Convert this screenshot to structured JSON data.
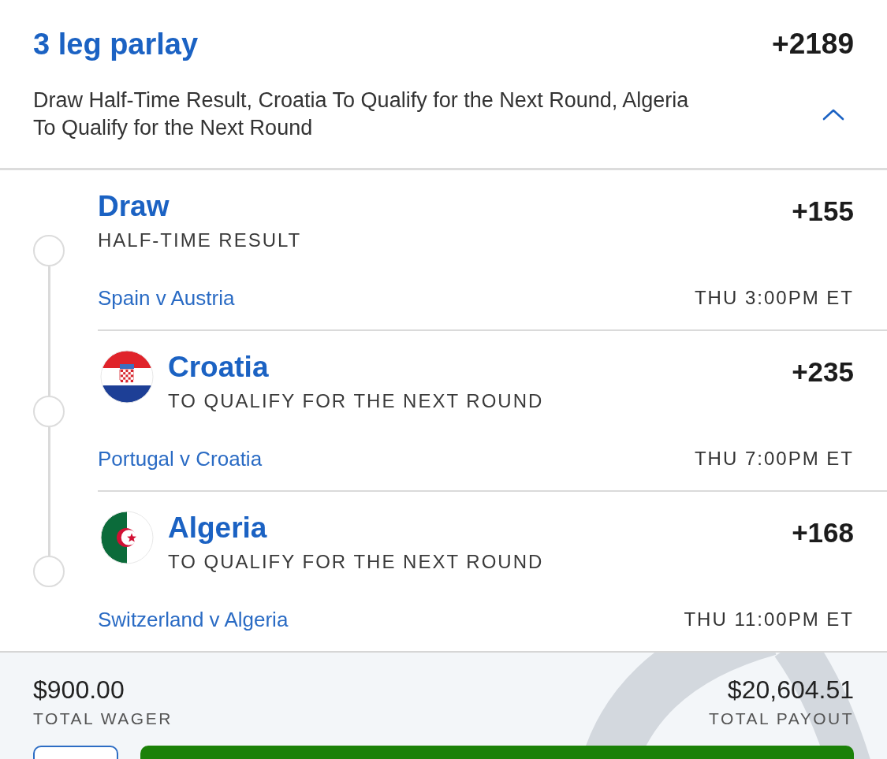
{
  "parlay": {
    "title": "3 leg parlay",
    "odds": "+2189",
    "description": "Draw Half-Time Result, Croatia To Qualify for the Next Round, Algeria To Qualify for the Next Round",
    "expanded": true
  },
  "legs": [
    {
      "kind": "plain",
      "selection": "Draw",
      "market": "HALF-TIME RESULT",
      "odds": "+155",
      "matchup": "Spain v Austria",
      "start_time": "THU 3:00PM ET"
    },
    {
      "kind": "croatia",
      "selection": "Croatia",
      "market": "TO QUALIFY FOR THE NEXT ROUND",
      "odds": "+235",
      "matchup": "Portugal v Croatia",
      "start_time": "THU 7:00PM ET"
    },
    {
      "kind": "algeria",
      "selection": "Algeria",
      "market": "TO QUALIFY FOR THE NEXT ROUND",
      "odds": "+168",
      "matchup": "Switzerland v Algeria",
      "start_time": "THU 11:00PM ET"
    }
  ],
  "summary": {
    "total_wager": "$900.00",
    "total_wager_label": "TOTAL WAGER",
    "total_payout": "$20,604.51",
    "total_payout_label": "TOTAL PAYOUT"
  }
}
